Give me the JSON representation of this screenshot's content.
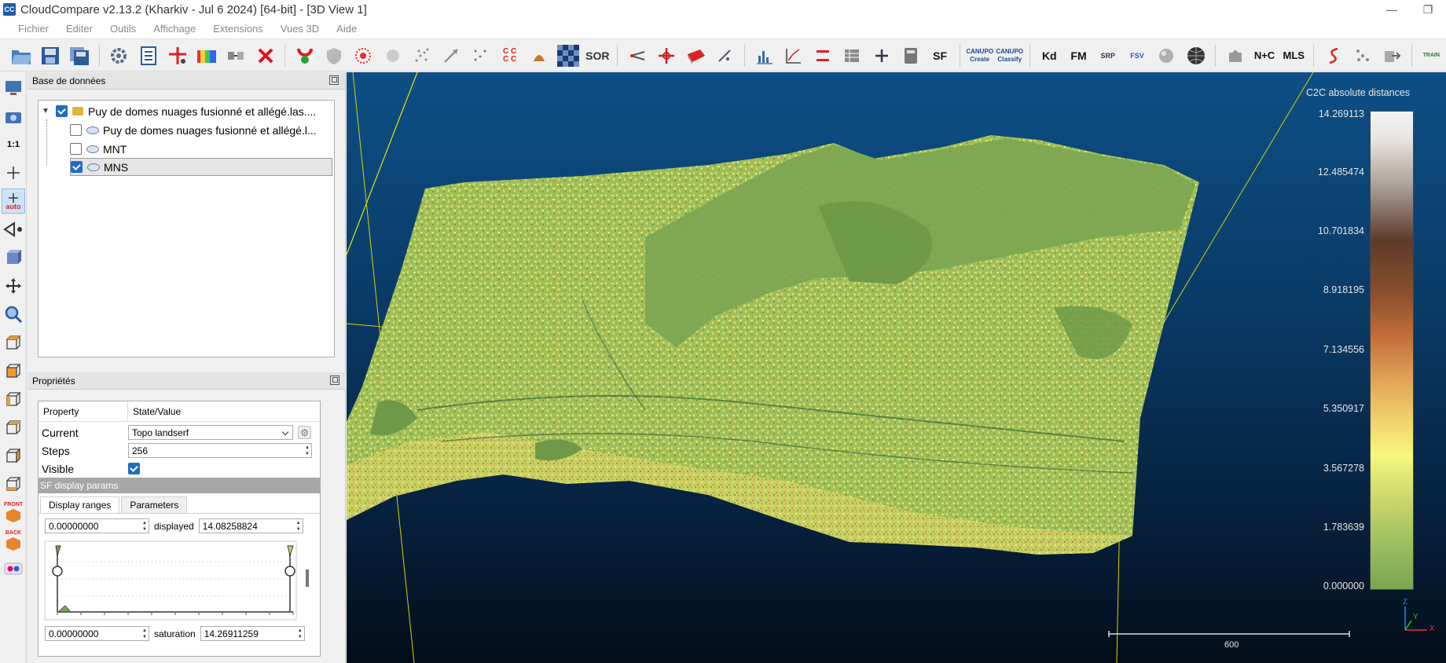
{
  "window": {
    "title": "CloudCompare v2.13.2 (Kharkiv - Jul  6 2024) [64-bit] - [3D View 1]",
    "app_icon": "CC",
    "min_glyph": "—",
    "max_glyph": "❐"
  },
  "menu": [
    "Fichier",
    "Editer",
    "Outils",
    "Affichage",
    "Extensions",
    "Vues 3D",
    "Aide"
  ],
  "toolbar": {
    "labels": {
      "ccc": "C C\nC C",
      "sor": "SOR",
      "sf": "SF",
      "canupo_create": "CANUPO\nCreate",
      "canupo_classify": "CANUPO\nClassify",
      "kd": "Kd",
      "fm": "FM",
      "srp": "SRP",
      "fsv": "FSV",
      "n_plus_c": "N+C",
      "mls": "MLS",
      "train": "TRAIN"
    }
  },
  "left_toolbar": {
    "one_to_one": "1:1",
    "auto": "auto",
    "front": "FRONT",
    "back": "BACK"
  },
  "db_panel": {
    "title": "Base de données",
    "root": {
      "label": "Puy de domes nuages fusionné et allégé.las....",
      "checked": true,
      "children": [
        {
          "label": "Puy de domes nuages fusionné et allégé.l...",
          "checked": false
        },
        {
          "label": "MNT",
          "checked": false
        },
        {
          "label": "MNS",
          "checked": true,
          "selected": true
        }
      ]
    }
  },
  "props_panel": {
    "title": "Propriétés",
    "col_property": "Property",
    "col_value": "State/Value",
    "current_label": "Current",
    "current_value": "Topo landserf",
    "steps_label": "Steps",
    "steps_value": "256",
    "visible_label": "Visible",
    "visible_checked": true,
    "section": "SF display params",
    "tab_display_ranges": "Display ranges",
    "tab_parameters": "Parameters",
    "range_min": "0.00000000",
    "displayed_label": "displayed",
    "displayed_value": "14.08258824",
    "sat_min": "0.00000000",
    "saturation_label": "saturation",
    "saturation_value": "14.26911259"
  },
  "view3d": {
    "colorbar_title": "C2C absolute distances",
    "colorbar_labels": [
      "14.269113",
      "12.485474",
      "10.701834",
      "8.918195",
      "7.134556",
      "5.350917",
      "3.567278",
      "1.783639",
      "0.000000"
    ],
    "scale_label": "600",
    "axis_z": "Z",
    "axis_y": "Y",
    "axis_x": "X"
  }
}
